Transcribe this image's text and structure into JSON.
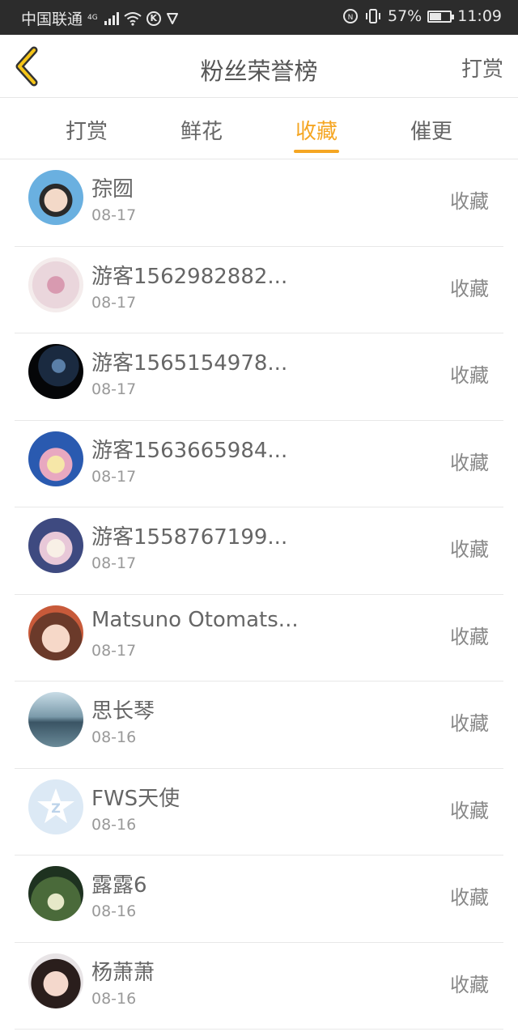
{
  "status_bar": {
    "carrier": "中国联通",
    "network": "4G",
    "battery": "57%",
    "battery_level": 0.57,
    "time": "11:09",
    "icons": [
      "signal-icon",
      "wifi-icon",
      "k-icon",
      "shield-icon",
      "nfc-icon",
      "vibrate-icon",
      "battery-icon"
    ]
  },
  "header": {
    "back_icon": "chevron-left-icon",
    "title": "粉丝荣誉榜",
    "action": "打赏"
  },
  "tabs": [
    {
      "label": "打赏",
      "active": false
    },
    {
      "label": "鲜花",
      "active": false
    },
    {
      "label": "收藏",
      "active": true
    },
    {
      "label": "催更",
      "active": false
    }
  ],
  "accent_color": "#f5a623",
  "fans": [
    {
      "name": "孮囫",
      "date": "08-17",
      "action": "收藏"
    },
    {
      "name": "游客1562982882...",
      "date": "08-17",
      "action": "收藏"
    },
    {
      "name": "游客1565154978...",
      "date": "08-17",
      "action": "收藏"
    },
    {
      "name": "游客1563665984...",
      "date": "08-17",
      "action": "收藏"
    },
    {
      "name": "游客1558767199...",
      "date": "08-17",
      "action": "收藏"
    },
    {
      "name": "Matsuno Otomats...",
      "date": "08-17",
      "action": "收藏"
    },
    {
      "name": "思长琴",
      "date": "08-16",
      "action": "收藏"
    },
    {
      "name": "FWS天使",
      "date": "08-16",
      "action": "收藏"
    },
    {
      "name": "露露6",
      "date": "08-16",
      "action": "收藏"
    },
    {
      "name": "杨萧萧",
      "date": "08-16",
      "action": "收藏"
    }
  ]
}
